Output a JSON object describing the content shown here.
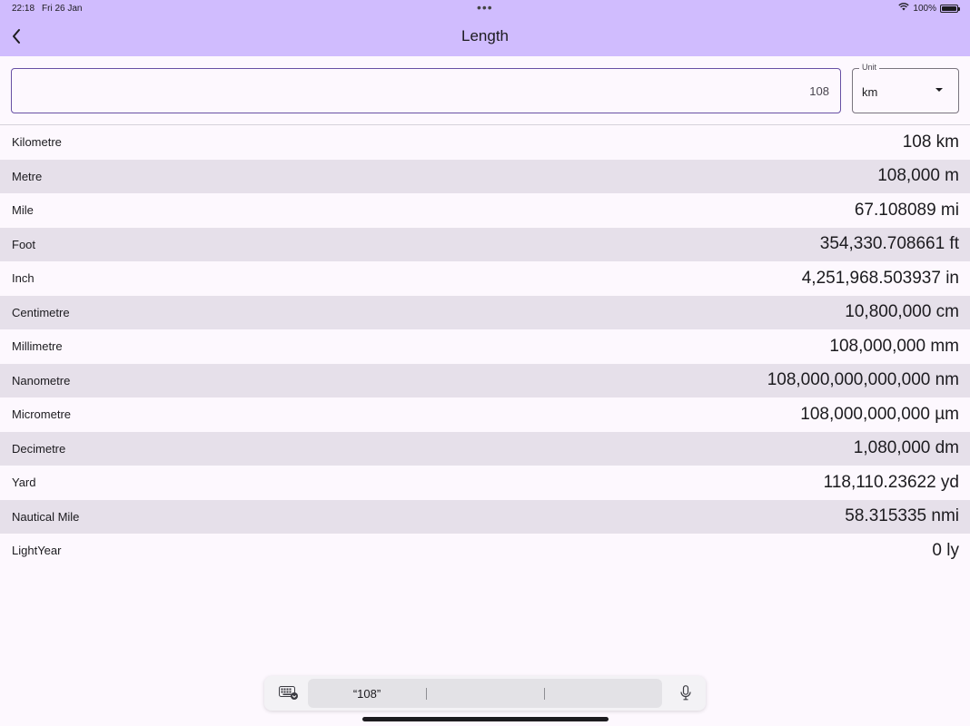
{
  "status": {
    "time": "22:18",
    "date": "Fri 26 Jan",
    "battery": "100%",
    "dots": "•••"
  },
  "appbar": {
    "title": "Length",
    "color": "#d0bcfe"
  },
  "input": {
    "value": "108"
  },
  "unit": {
    "label": "Unit",
    "selected": "km"
  },
  "rows": [
    {
      "name": "Kilometre",
      "value": "108 km"
    },
    {
      "name": "Metre",
      "value": "108,000 m"
    },
    {
      "name": "Mile",
      "value": "67.108089 mi"
    },
    {
      "name": "Foot",
      "value": "354,330.708661 ft"
    },
    {
      "name": "Inch",
      "value": "4,251,968.503937 in"
    },
    {
      "name": "Centimetre",
      "value": "10,800,000 cm"
    },
    {
      "name": "Millimetre",
      "value": "108,000,000 mm"
    },
    {
      "name": "Nanometre",
      "value": "108,000,000,000,000 nm"
    },
    {
      "name": "Micrometre",
      "value": "108,000,000,000 µm"
    },
    {
      "name": "Decimetre",
      "value": "1,080,000 dm"
    },
    {
      "name": "Yard",
      "value": "118,110.23622 yd"
    },
    {
      "name": "Nautical Mile",
      "value": "58.315335 nmi"
    },
    {
      "name": "LightYear",
      "value": "0 ly"
    }
  ],
  "keyboard": {
    "suggestions": [
      "“108”",
      "",
      ""
    ]
  }
}
